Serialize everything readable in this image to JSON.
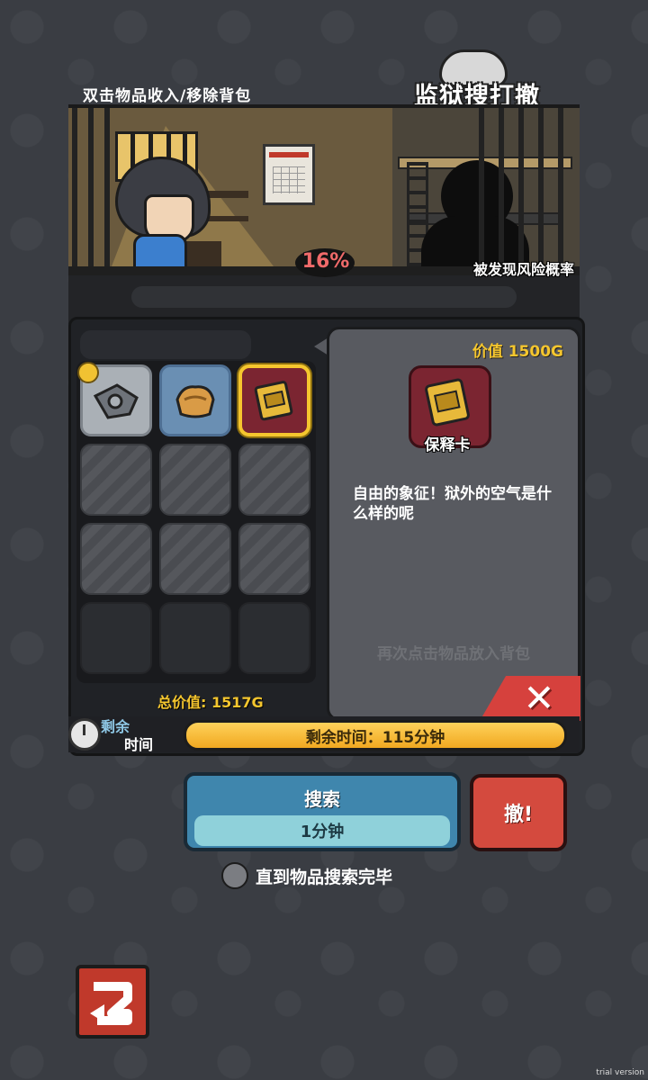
{
  "header": {
    "instruction": "双击物品收入/移除背包",
    "logo_text": "监狱搜打撤"
  },
  "scene": {
    "risk_percent": "16%",
    "risk_label": "被发现风险概率"
  },
  "inventory": {
    "slots": [
      {
        "state": "item",
        "item": "wrench-icon",
        "color": "gray",
        "badge": "coin"
      },
      {
        "state": "item",
        "item": "bread-icon",
        "color": "blue"
      },
      {
        "state": "item-selected",
        "item": "parole-card-icon",
        "color": "red"
      },
      {
        "state": "locked"
      },
      {
        "state": "locked"
      },
      {
        "state": "locked"
      },
      {
        "state": "locked"
      },
      {
        "state": "locked"
      },
      {
        "state": "locked"
      },
      {
        "state": "empty"
      },
      {
        "state": "empty"
      },
      {
        "state": "empty"
      }
    ],
    "total_value": "总价值: 1517G"
  },
  "detail": {
    "price": "价值 1500G",
    "item_name": "保释卡",
    "description": "自由的象征！狱外的空气是什么样的呢",
    "hint": "再次点击物品放入背包",
    "close_icon": "close-icon"
  },
  "timer": {
    "label_top": "剩余",
    "label_bottom": "时间",
    "remaining_text": "剩余时间：115分钟"
  },
  "actions": {
    "search_label": "搜索",
    "search_duration": "1分钟",
    "escape_label": "撤!",
    "until_done_label": "直到物品搜索完毕"
  },
  "footer": {
    "trial_text": "trial version"
  },
  "colors": {
    "background": "#3a3d43",
    "accent_gold": "#f5c62e",
    "danger_red": "#d44a3e",
    "search_blue": "#3f86ad"
  }
}
